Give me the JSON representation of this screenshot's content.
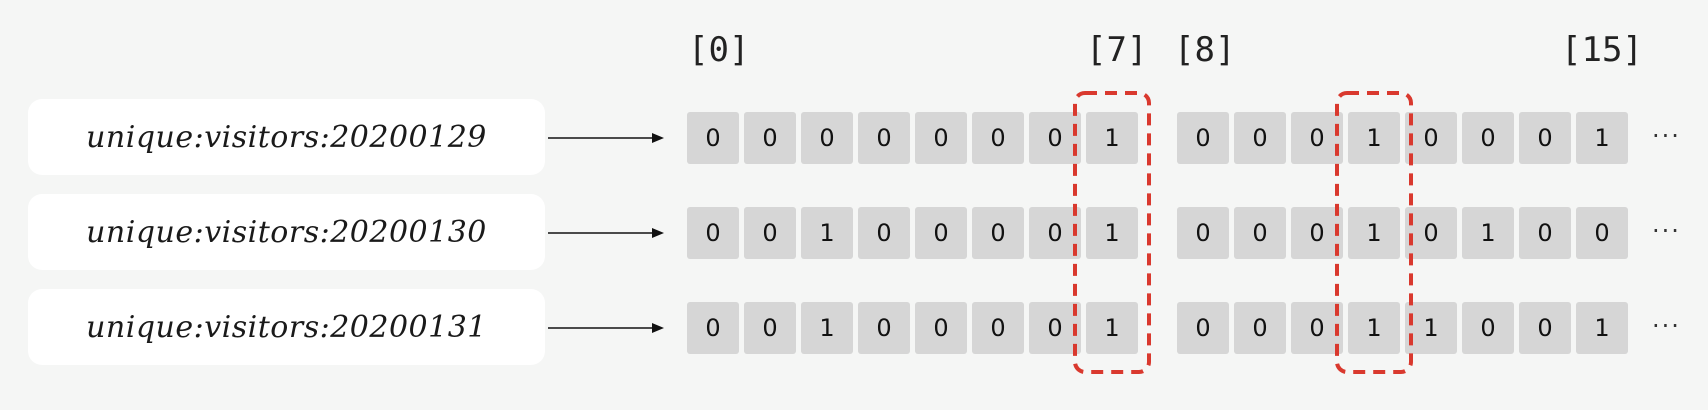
{
  "index_labels": [
    "[0]",
    "[7]",
    "[8]",
    "[15]"
  ],
  "rows": [
    {
      "key": "unique:visitors:20200129",
      "bits": [
        "0",
        "0",
        "0",
        "0",
        "0",
        "0",
        "0",
        "1",
        "0",
        "0",
        "0",
        "1",
        "0",
        "0",
        "0",
        "1"
      ],
      "ellipsis": "···"
    },
    {
      "key": "unique:visitors:20200130",
      "bits": [
        "0",
        "0",
        "1",
        "0",
        "0",
        "0",
        "0",
        "1",
        "0",
        "0",
        "0",
        "1",
        "0",
        "1",
        "0",
        "0"
      ],
      "ellipsis": "···"
    },
    {
      "key": "unique:visitors:20200131",
      "bits": [
        "0",
        "0",
        "1",
        "0",
        "0",
        "0",
        "0",
        "1",
        "0",
        "0",
        "0",
        "1",
        "1",
        "0",
        "0",
        "1"
      ],
      "ellipsis": "···"
    }
  ],
  "highlighted_bit_indices": [
    7,
    11
  ],
  "colors": {
    "highlight": "#d9392e",
    "cell": "#d6d6d6",
    "key_box": "#ffffff",
    "background": "#f5f6f5"
  }
}
